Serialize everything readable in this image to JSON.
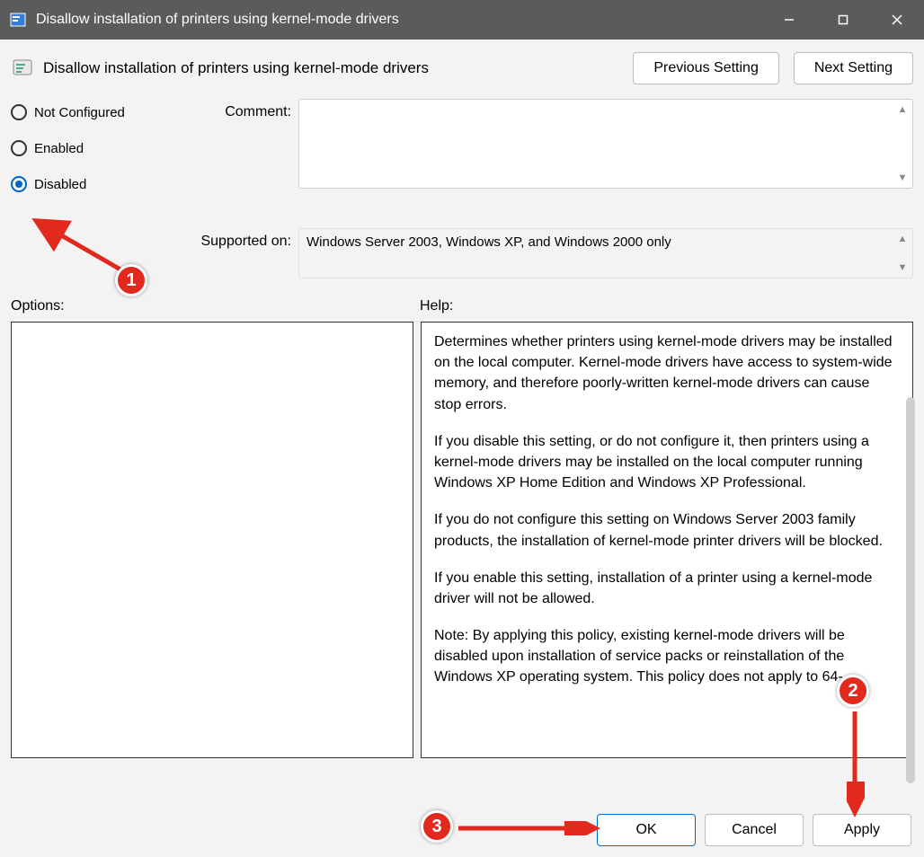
{
  "window": {
    "title": "Disallow installation of printers using kernel-mode drivers"
  },
  "header": {
    "title": "Disallow installation of printers using kernel-mode drivers",
    "prev_label": "Previous Setting",
    "next_label": "Next Setting"
  },
  "state": {
    "options": [
      {
        "label": "Not Configured",
        "selected": false
      },
      {
        "label": "Enabled",
        "selected": false
      },
      {
        "label": "Disabled",
        "selected": true
      }
    ]
  },
  "fields": {
    "comment_label": "Comment:",
    "comment_value": "",
    "supported_label": "Supported on:",
    "supported_value": "Windows Server 2003, Windows XP, and Windows 2000 only"
  },
  "sections": {
    "options_label": "Options:",
    "help_label": "Help:"
  },
  "help": {
    "p1": "Determines whether printers using kernel-mode drivers may be installed on the local computer.  Kernel-mode drivers have access to system-wide memory, and therefore poorly-written kernel-mode drivers can cause stop errors.",
    "p2": "If you disable this setting, or do not configure it, then printers using a kernel-mode drivers may be installed on the local computer running Windows XP Home Edition and Windows XP Professional.",
    "p3": "If you do not configure this setting on Windows Server 2003 family products, the installation of kernel-mode printer drivers will be blocked.",
    "p4": "If you enable this setting, installation of a printer using a kernel-mode driver will not be allowed.",
    "p5": "Note: By applying this policy, existing kernel-mode drivers will be disabled upon installation of service packs or reinstallation of the Windows XP operating system. This policy does not apply to 64-"
  },
  "footer": {
    "ok": "OK",
    "cancel": "Cancel",
    "apply": "Apply"
  },
  "annotations": {
    "c1": "1",
    "c2": "2",
    "c3": "3"
  }
}
